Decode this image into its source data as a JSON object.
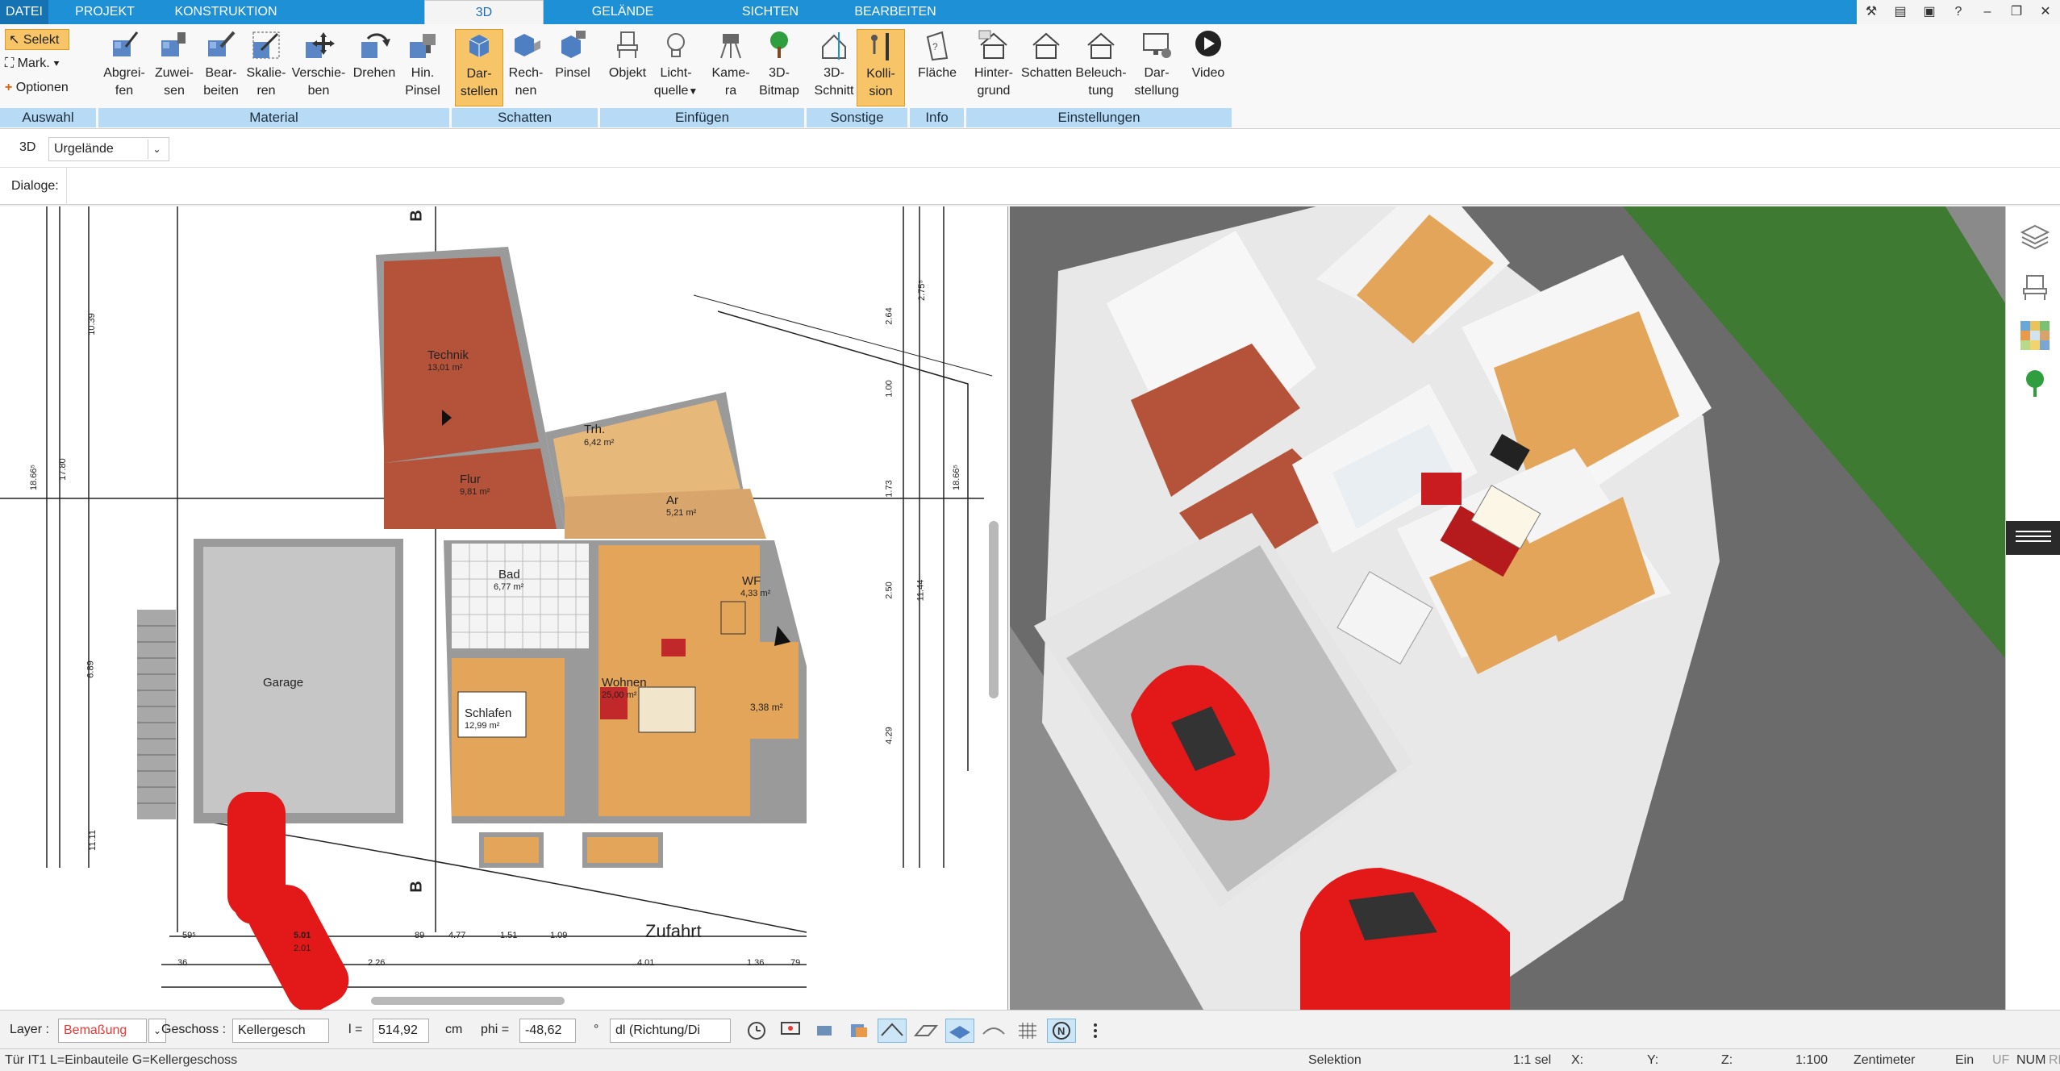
{
  "tabs": [
    "DATEI",
    "PROJEKT",
    "KONSTRUKTION",
    "3D",
    "GELÄNDE",
    "SICHTEN",
    "BEARBEITEN"
  ],
  "active_tab": "3D",
  "selection": {
    "selekt": "Selekt",
    "mark": "Mark.",
    "optionen": "Optionen"
  },
  "ribbon": {
    "material": [
      "Abgrei-\nfen",
      "Zuwei-\nsen",
      "Bear-\nbeiten",
      "Skalie-\nren",
      "Verschie-\nben",
      "Drehen",
      "Hin.\nPinsel"
    ],
    "schatten": [
      "Dar-\nstellen",
      "Rech-\nnen",
      "Pinsel"
    ],
    "einfuegen": [
      "Objekt",
      "Licht-\nquelle",
      "Kame-\nra",
      "3D-\nBitmap"
    ],
    "sonstige": [
      "3D-\nSchnitt",
      "Kolli-\nsion"
    ],
    "info": [
      "Fläche"
    ],
    "einstellungen": [
      "Hinter-\ngrund",
      "Schatten",
      "Beleuch-\ntung",
      "Dar-\nstellung",
      "Video"
    ]
  },
  "groups": {
    "auswahl": "Auswahl",
    "material": "Material",
    "schatten": "Schatten",
    "einfuegen": "Einfügen",
    "sonstige": "Sonstige",
    "info": "Info",
    "einstellungen": "Einstellungen"
  },
  "view_row": {
    "mode": "3D",
    "terrain": "Urgelände"
  },
  "dialog_row": {
    "label": "Dialoge:"
  },
  "plan": {
    "rooms": [
      {
        "name": "Technik",
        "area": "13,01 m²"
      },
      {
        "name": "Trh.",
        "area": "6,42 m²"
      },
      {
        "name": "Flur",
        "area": "9,81 m²"
      },
      {
        "name": "Ar",
        "area": "5,21 m²"
      },
      {
        "name": "Bad",
        "area": "6,77 m²"
      },
      {
        "name": "WF",
        "area": "4,33 m²"
      },
      {
        "name": "Garage",
        "area": ""
      },
      {
        "name": "Wohnen",
        "area": "25,00 m²"
      },
      {
        "name": "Schlafen",
        "area": "12,99 m²"
      },
      {
        "name": "",
        "area": "3,38 m²"
      }
    ],
    "street": "Zufahrt",
    "dims_v": [
      "10.39",
      "17.80",
      "18.66⁵",
      "6.89",
      "11.11",
      "2.75⁵",
      "2.64",
      "1.00",
      "1.73",
      "2.50",
      "4.29",
      "11.44",
      "18.66⁵"
    ],
    "dims_h": [
      "5.01",
      "2.01",
      "89",
      "4.77",
      "1.51",
      "1.09",
      "4.01",
      "1.36",
      "79",
      "2.26",
      "59⁵",
      "36"
    ],
    "section_marks": [
      "B",
      "B"
    ]
  },
  "status": {
    "layer_label": "Layer :",
    "layer_value": "Bemaßung",
    "geschoss_label": "Geschoss :",
    "geschoss_value": "Kellergesch",
    "l_label": "l =",
    "l_value": "514,92",
    "l_unit": "cm",
    "phi_label": "phi =",
    "phi_value": "-48,62",
    "phi_unit": "°",
    "dl_value": "dl (Richtung/Di"
  },
  "status2": {
    "left": "Tür IT1 L=Einbauteile G=Kellergeschoss",
    "mode": "Selektion",
    "scale_sel": "1:1 sel",
    "x": "X:",
    "y": "Y:",
    "z": "Z:",
    "scale": "1:100",
    "unit": "Zentimeter",
    "ein": "Ein",
    "uf": "UF",
    "num": "NUM",
    "rf": "RF"
  },
  "colors": {
    "tab_blue": "#1e90d6",
    "group_blue": "#b7dbf5",
    "selected_btn": "#f7c568",
    "layer_red": "#e53935"
  }
}
